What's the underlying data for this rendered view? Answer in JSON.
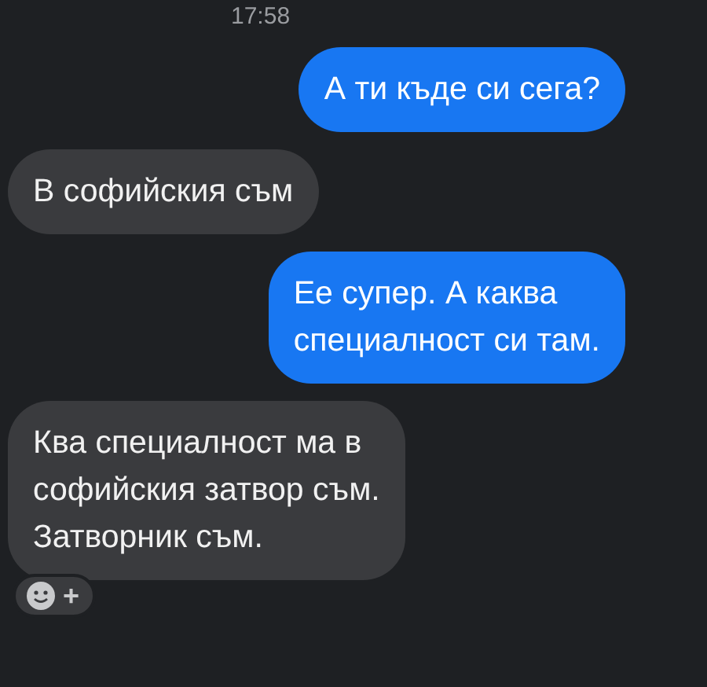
{
  "time": "17:58",
  "messages": [
    {
      "kind": "sent",
      "text": "А ти къде си сега?"
    },
    {
      "kind": "received",
      "text": "В софийския съм"
    },
    {
      "kind": "sent",
      "text": "Ее супер. А каква\nспециалност си там."
    },
    {
      "kind": "received",
      "text": "Ква специалност ма в\nсофийския затвор съм.\nЗатворник съм.",
      "reaction_button": {
        "symbol": "+"
      }
    }
  ]
}
